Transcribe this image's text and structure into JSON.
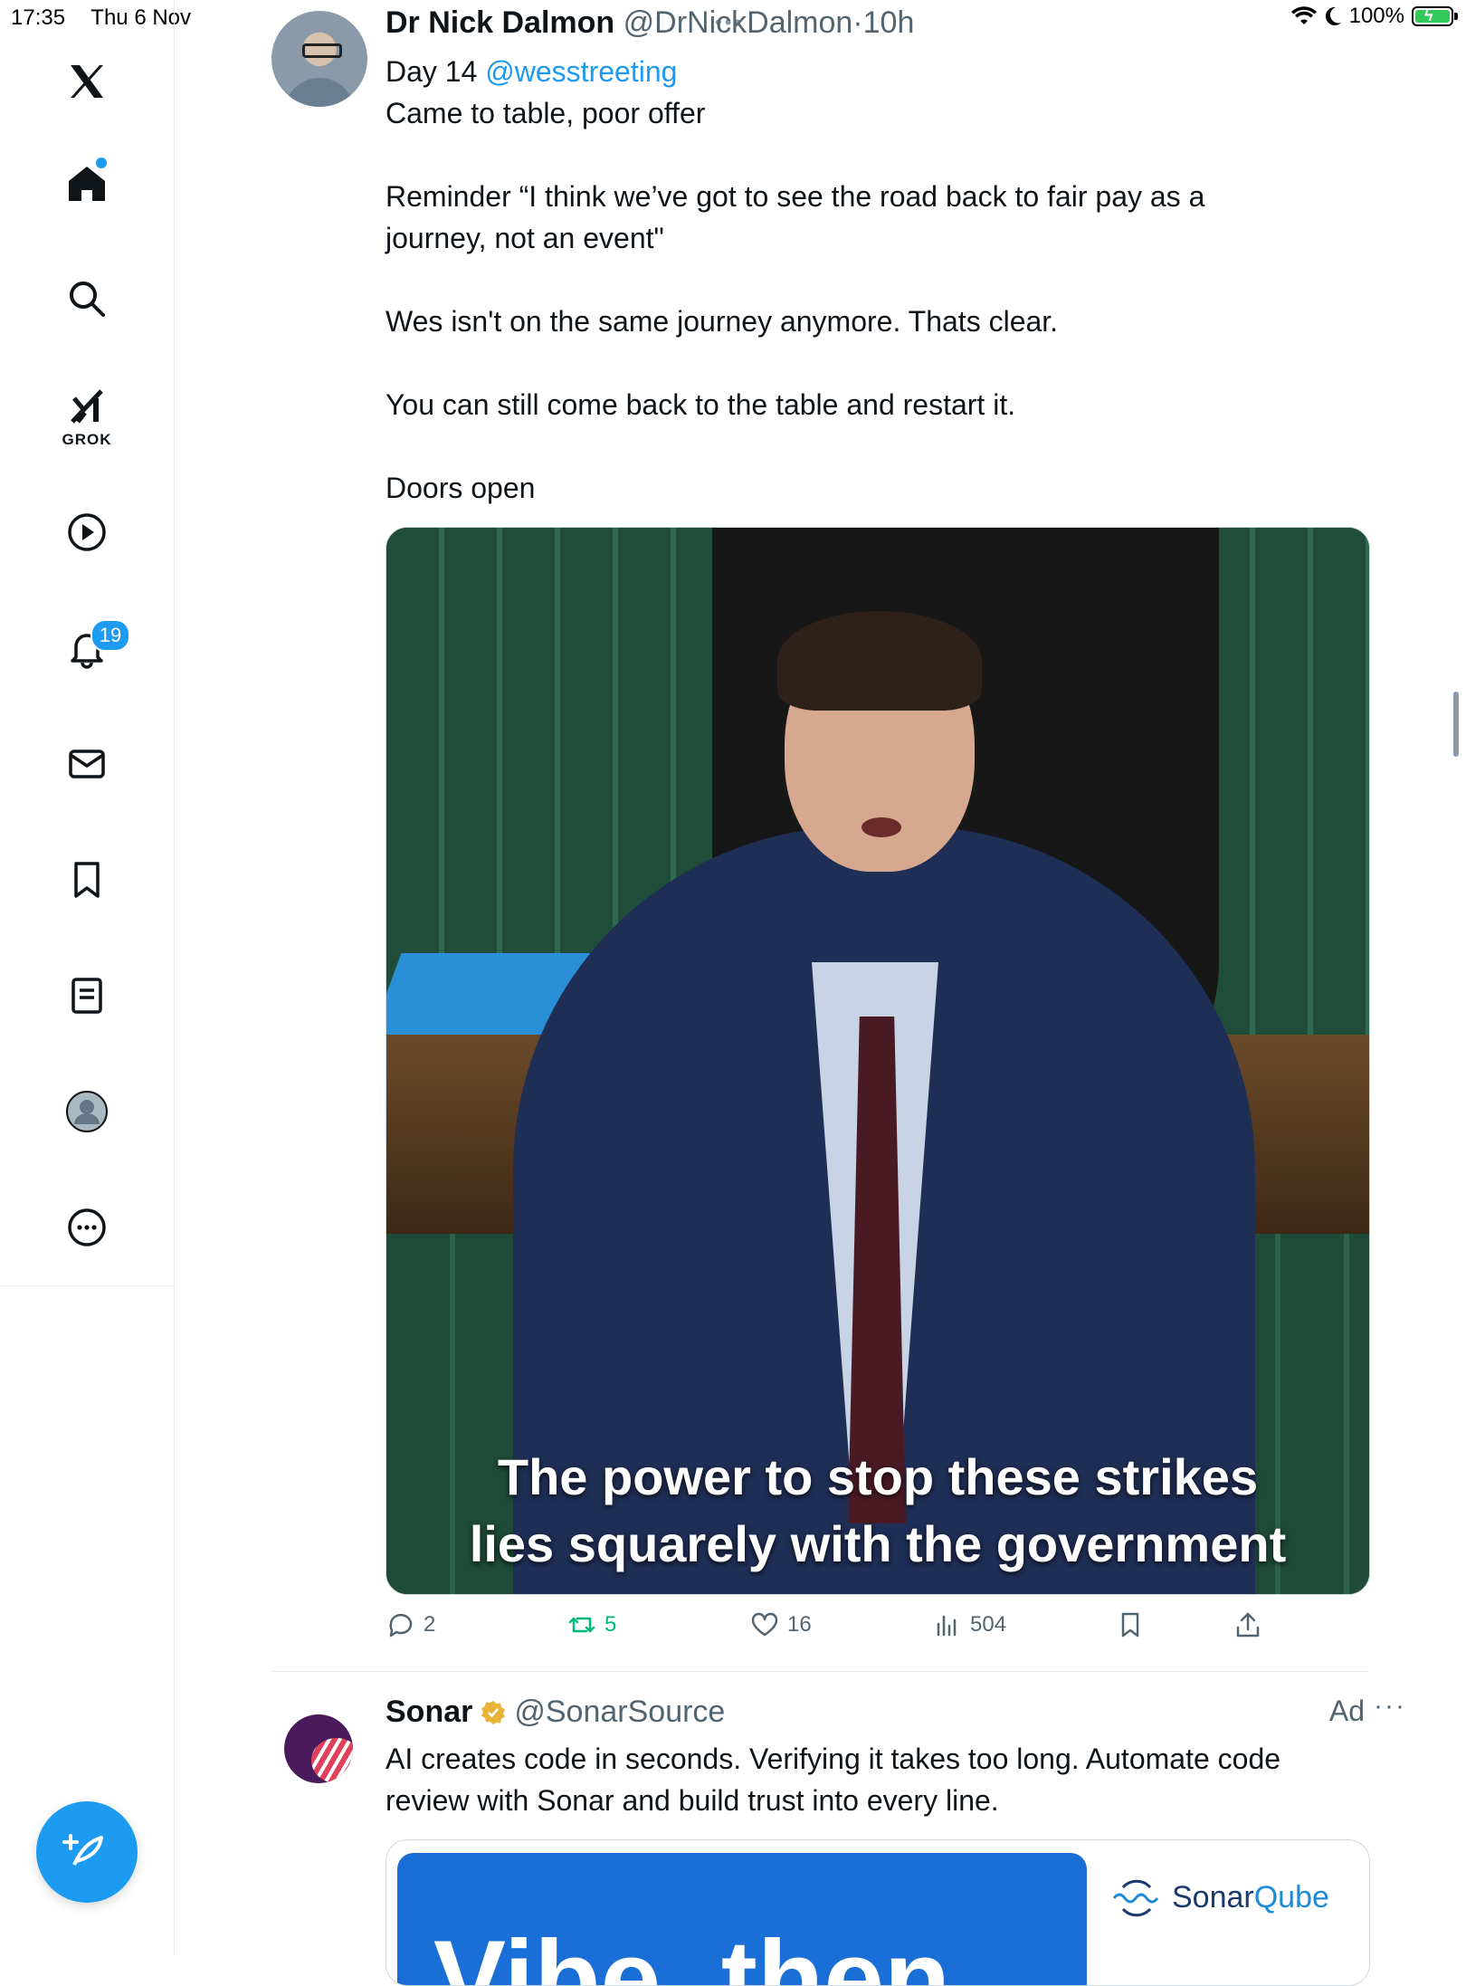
{
  "status_bar": {
    "time": "17:35",
    "date": "Thu 6 Nov",
    "battery": "100%",
    "colors": {
      "battery_fill": "#34c759"
    }
  },
  "sidebar": {
    "items": [
      {
        "name": "X",
        "icon": "x-logo-icon"
      },
      {
        "name": "Home",
        "icon": "home-icon",
        "has_dot": true
      },
      {
        "name": "Search",
        "icon": "search-icon"
      },
      {
        "name": "Grok",
        "icon": "grok-icon",
        "label": "GROK"
      },
      {
        "name": "Videos",
        "icon": "play-icon"
      },
      {
        "name": "Notifications",
        "icon": "bell-icon",
        "badge": "19"
      },
      {
        "name": "Messages",
        "icon": "mail-icon"
      },
      {
        "name": "Bookmarks",
        "icon": "bookmark-icon"
      },
      {
        "name": "Lists",
        "icon": "list-icon"
      },
      {
        "name": "Profile",
        "icon": "profile-icon"
      },
      {
        "name": "More",
        "icon": "more-circle-icon"
      }
    ],
    "compose_icon": "compose-icon"
  },
  "tweet": {
    "author_name": "Dr Nick Dalmon",
    "handle": "@DrNickDalmon",
    "separator": "·",
    "time": "10h",
    "line1_prefix": "Day 14",
    "line1_mention": "@wesstreeting",
    "line2": "Came to table, poor offer",
    "line3a": "Reminder “I think we’ve got to see the road back to fair pay as a",
    "line3b": "journey,  not an event\"",
    "line4": "Wes isn't on the same journey anymore. Thats clear.",
    "line5": "You can still come back to the table and restart it.",
    "line6": "Doors open",
    "media_caption_1": "The power to stop these strikes",
    "media_caption_2": "lies squarely with the government",
    "actions": {
      "replies": "2",
      "reposts": "5",
      "likes": "16",
      "views": "504"
    },
    "colors": {
      "mention": "#1d9bf0",
      "repost": "#00ba7c"
    }
  },
  "ad": {
    "name": "Sonar",
    "handle": "@SonarSource",
    "label": "Ad",
    "more": "···",
    "body_1": "AI creates code in seconds. Verifying it takes too long. Automate code",
    "body_2": "review with Sonar and build trust into every line.",
    "card_text": "Vibe, then",
    "brand_a": "Sonar",
    "brand_b": "Qube",
    "colors": {
      "card_blue": "#1a6fd6",
      "verified": "#e8b339"
    }
  }
}
